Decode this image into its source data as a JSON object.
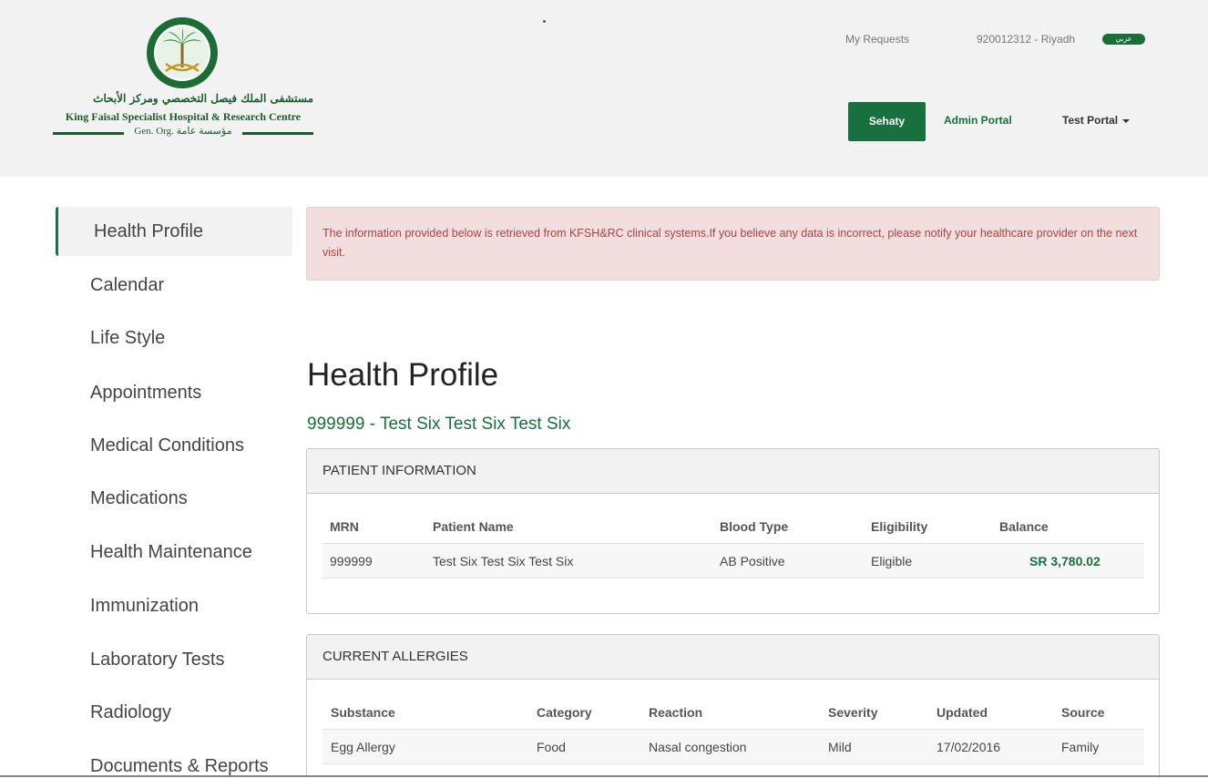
{
  "header": {
    "logo": {
      "arabic_name": "مستشفى الملك فيصل التخصصي ومركز الأبحاث",
      "english_name": "King Faisal Specialist Hospital & Research Centre",
      "org_line": "Gen. Org. مؤسسة عامة"
    },
    "top_links": {
      "my_requests": "My Requests",
      "phone_city": "920012312 - Riyadh",
      "language_toggle": "عربي"
    },
    "nav": {
      "sehaty": "Sehaty",
      "admin_portal": "Admin Portal",
      "test_portal": "Test Portal"
    }
  },
  "sidebar": {
    "items": [
      {
        "label": "Health Profile",
        "active": true
      },
      {
        "label": "Calendar"
      },
      {
        "label": "Life Style"
      },
      {
        "label": "Appointments"
      },
      {
        "label": "Medical Conditions"
      },
      {
        "label": "Medications"
      },
      {
        "label": "Health Maintenance"
      },
      {
        "label": "Immunization"
      },
      {
        "label": "Laboratory Tests"
      },
      {
        "label": "Radiology"
      },
      {
        "label": "Documents & Reports"
      }
    ]
  },
  "main": {
    "alert_text": "The information provided below is retrieved from KFSH&RC clinical systems.If you believe any data is incorrect, please notify your healthcare provider on the next visit.",
    "title": "Health Profile",
    "patient_line": "999999 - Test Six Test Six Test Six",
    "patient_info": {
      "heading": "PATIENT INFORMATION",
      "columns": [
        "MRN",
        "Patient Name",
        "Blood Type",
        "Eligibility",
        "Balance"
      ],
      "row": [
        "999999",
        "Test Six Test Six Test Six",
        "AB Positive",
        "Eligible",
        "SR 3,780.02"
      ]
    },
    "allergies": {
      "heading": "CURRENT ALLERGIES",
      "columns": [
        "Substance",
        "Category",
        "Reaction",
        "Severity",
        "Updated",
        "Source"
      ],
      "rows": [
        [
          "Egg Allergy",
          "Food",
          "Nasal congestion",
          "Mild",
          "17/02/2016",
          "Family"
        ]
      ]
    }
  },
  "colors": {
    "brand_green": "#17703d",
    "alert_bg": "#f2dede",
    "alert_text": "#a94442"
  }
}
